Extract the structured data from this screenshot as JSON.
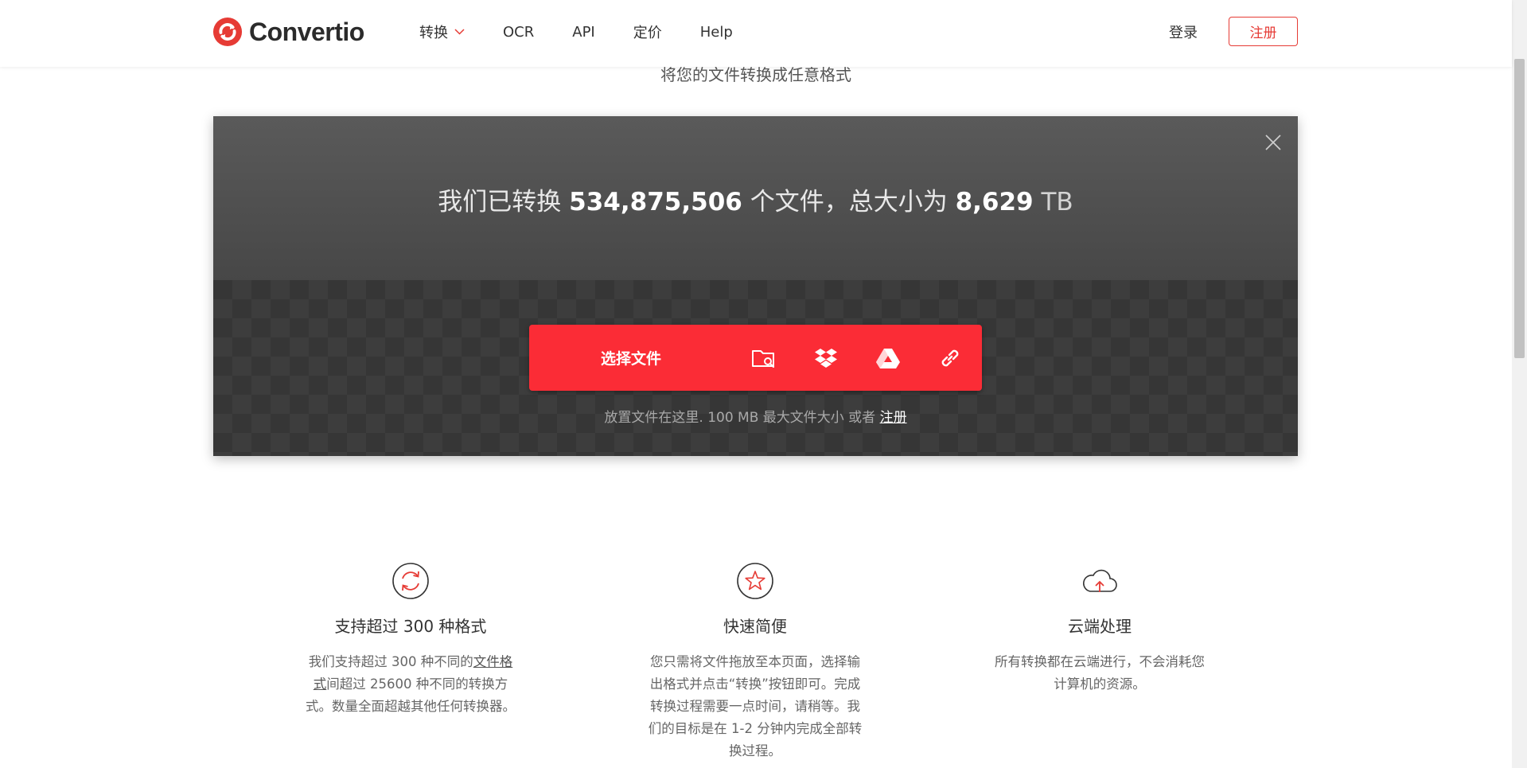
{
  "header": {
    "logo_text": "Convertio",
    "nav": [
      {
        "label": "转换",
        "has_dropdown": true
      },
      {
        "label": "OCR"
      },
      {
        "label": "API"
      },
      {
        "label": "定价"
      },
      {
        "label": "Help"
      }
    ],
    "login_label": "登录",
    "register_label": "注册"
  },
  "tagline": "将您的文件转换成任意格式",
  "panel": {
    "stats_prefix": "我们已转换 ",
    "files_count": "534,875,506",
    "stats_middle": " 个文件，总大小为 ",
    "total_size": "8,629",
    "size_unit": " TB",
    "choose_files_label": "选择文件",
    "upload_sources": [
      "folder-search-icon",
      "dropbox-icon",
      "google-drive-icon",
      "url-link-icon"
    ],
    "drop_hint": "放置文件在这里. 100 MB 最大文件大小 或者 ",
    "drop_hint_link": "注册"
  },
  "features": [
    {
      "icon": "refresh-icon",
      "title": "支持超过 300 种格式",
      "desc_before": "我们支持超过 300 种不同的",
      "desc_link": "文件格式",
      "desc_after": "间超过 25600 种不同的转换方式。数量全面超越其他任何转换器。"
    },
    {
      "icon": "star-icon",
      "title": "快速简便",
      "desc": "您只需将文件拖放至本页面，选择输出格式并点击“转换”按钮即可。完成转换过程需要一点时间，请稍等。我们的目标是在 1-2 分钟内完成全部转换过程。"
    },
    {
      "icon": "cloud-upload-icon",
      "title": "云端处理",
      "desc": "所有转换都在云端进行，不会消耗您计算机的资源。"
    }
  ],
  "colors": {
    "accent": "#fb2c36",
    "brand_red": "#e63b35",
    "panel_top": "#4f4f4f",
    "panel_bottom": "#363636"
  }
}
